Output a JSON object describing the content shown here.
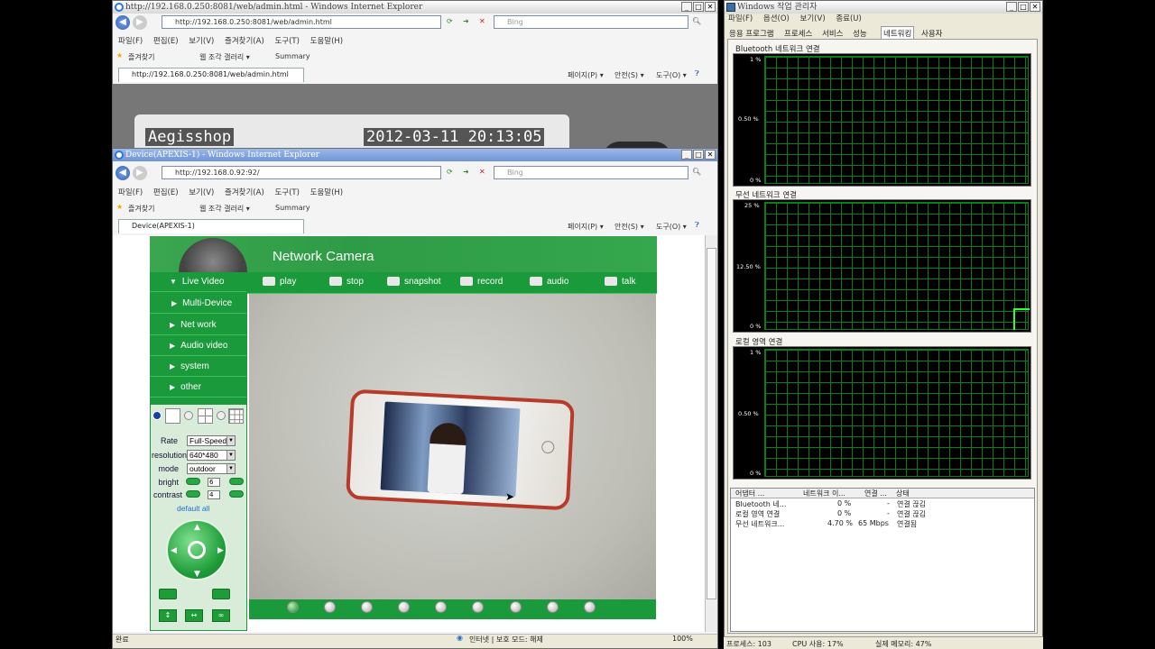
{
  "back_window": {
    "title": "http://192.168.0.250:8081/web/admin.html - Windows Internet Explorer",
    "address": "http://192.168.0.250:8081/web/admin.html",
    "search": "Bing",
    "menu": [
      "파일(F)",
      "편집(E)",
      "보기(V)",
      "즐겨찾기(A)",
      "도구(T)",
      "도움말(H)"
    ],
    "favorites": "즐겨찾기",
    "web_slice": "웹 조각 갤러리 ▾",
    "summary": "Summary",
    "tab": "http://192.168.0.250:8081/web/admin.html",
    "cmd_page": "페이지(P) ▾",
    "cmd_safety": "안전(S) ▾",
    "cmd_tools": "도구(O) ▾",
    "osd_name": "Aegisshop",
    "osd_time": "2012-03-11 20:13:05"
  },
  "front_window": {
    "title": "Device(APEXIS-1) - Windows Internet Explorer",
    "address": "http://192.168.0.92:92/",
    "search": "Bing",
    "menu": [
      "파일(F)",
      "편집(E)",
      "보기(V)",
      "즐겨찾기(A)",
      "도구(T)",
      "도움말(H)"
    ],
    "favorites": "즐겨찾기",
    "web_slice": "웹 조각 갤러리 ▾",
    "summary": "Summary",
    "tab": "Device(APEXIS-1)",
    "cmd_page": "페이지(P) ▾",
    "cmd_safety": "안전(S) ▾",
    "cmd_tools": "도구(O) ▾",
    "status_done": "완료",
    "status_zone": "인터넷 | 보호 모드: 해제",
    "status_zoom": "100%"
  },
  "camera": {
    "header_title": "Network Camera",
    "toolbar": [
      "play",
      "stop",
      "snapshot",
      "record",
      "audio",
      "talk"
    ],
    "side_menu": [
      "Live Video",
      "Multi-Device",
      "Net work",
      "Audio video",
      "system",
      "other"
    ],
    "controls": {
      "rate_label": "Rate",
      "rate_value": "Full-Speed",
      "resolution_label": "resolution",
      "resolution_value": "640*480",
      "mode_label": "mode",
      "mode_value": "outdoor",
      "bright_label": "bright",
      "bright_value": "6",
      "contrast_label": "contrast",
      "contrast_value": "4",
      "default_all": "default all"
    }
  },
  "task_manager": {
    "title": "Windows 작업 관리자",
    "menu": [
      "파일(F)",
      "옵션(O)",
      "보기(V)",
      "종료(U)"
    ],
    "tabs": [
      "응용 프로그램",
      "프로세스",
      "서비스",
      "성능",
      "네트워킹",
      "사용자"
    ],
    "graphs": [
      {
        "title": "Bluetooth 네트워크 연결",
        "ymax": "1 %",
        "ymid": "0.50 %",
        "ymin": "0 %"
      },
      {
        "title": "무선 네트워크 연결",
        "ymax": "25 %",
        "ymid": "12.50 %",
        "ymin": "0 %"
      },
      {
        "title": "로컬 영역 연결",
        "ymax": "1 %",
        "ymid": "0.50 %",
        "ymin": "0 %"
      }
    ],
    "columns": [
      "어댑터 ...",
      "네트워크 이...",
      "연결 ...",
      "상태"
    ],
    "rows": [
      [
        "Bluetooth 네...",
        "0 %",
        "-",
        "연결 끊김"
      ],
      [
        "로컬 영역 연결",
        "0 %",
        "-",
        "연결 끊김"
      ],
      [
        "무선 네트워크...",
        "4.70 %",
        "65 Mbps",
        "연결됨"
      ]
    ],
    "status": {
      "processes": "프로세스: 103",
      "cpu": "CPU 사용: 17%",
      "memory": "실제 메모리: 47%"
    }
  }
}
